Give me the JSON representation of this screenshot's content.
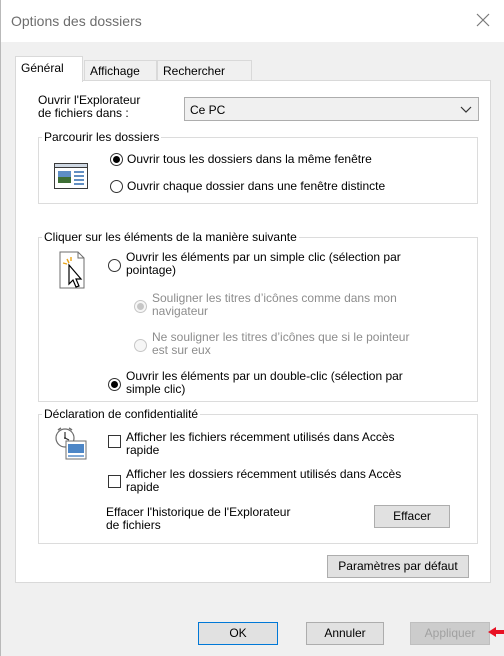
{
  "window": {
    "title": "Options des dossiers",
    "close_glyph": "✕"
  },
  "tabs": [
    {
      "label": "Général",
      "active": true
    },
    {
      "label": "Affichage",
      "active": false
    },
    {
      "label": "Rechercher",
      "active": false
    }
  ],
  "open_explorer": {
    "label": "Ouvrir l'Explorateur de fichiers dans :",
    "label_line1": "Ouvrir l'Explorateur",
    "label_line2": "de fichiers dans :",
    "value": "Ce PC"
  },
  "browse": {
    "title": "Parcourir les dossiers",
    "options": [
      {
        "label": "Ouvrir tous les dossiers dans la même fenêtre",
        "checked": true
      },
      {
        "label": "Ouvrir chaque dossier dans une fenêtre distincte",
        "checked": false
      }
    ]
  },
  "click": {
    "title": "Cliquer sur les éléments de la manière suivante",
    "single_click": {
      "line1": "Ouvrir les éléments par un simple clic (sélection par",
      "line2": "pointage)",
      "checked": false
    },
    "underline_always": {
      "line1": "Souligner les titres d’icônes comme dans mon",
      "line2": "navigateur",
      "checked": true,
      "disabled": true
    },
    "underline_hover": {
      "line1": "Ne souligner les titres d’icônes que si le pointeur",
      "line2": "est sur eux",
      "checked": false,
      "disabled": true
    },
    "double_click": {
      "line1": "Ouvrir les éléments par un double-clic (sélection par",
      "line2": "simple clic)",
      "checked": true
    }
  },
  "privacy": {
    "title": "Déclaration de confidentialité",
    "recent_files": {
      "line1": "Afficher les fichiers récemment utilisés dans Accès",
      "line2": "rapide",
      "checked": false
    },
    "recent_folders": {
      "line1": "Afficher les dossiers récemment utilisés dans Accès",
      "line2": "rapide",
      "checked": false
    },
    "clear_history": {
      "line1": "Effacer l'historique de l'Explorateur",
      "line2": "de fichiers"
    },
    "clear_button": "Effacer"
  },
  "restore_defaults_button": "Paramètres par défaut",
  "footer": {
    "ok": "OK",
    "cancel": "Annuler",
    "apply": "Appliquer"
  },
  "colors": {
    "selection_blue": "#0078d7",
    "annotation_arrow": "#e81123",
    "dialog_bg": "#f0f0f0"
  },
  "icons": [
    "close-icon",
    "chevron-down-icon",
    "folder-window-icon",
    "pointer-click-icon",
    "privacy-clock-icon",
    "red-arrow-icon"
  ]
}
